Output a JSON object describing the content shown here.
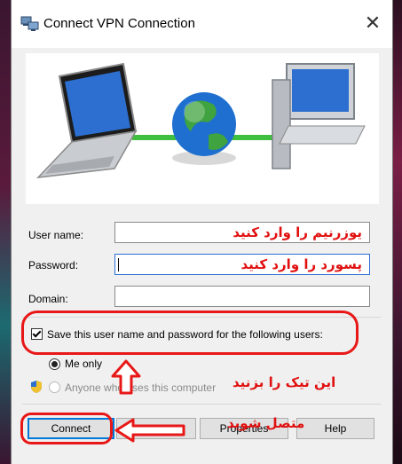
{
  "window": {
    "title": "Connect VPN Connection",
    "close_glyph": "✕"
  },
  "form": {
    "username_label": "User name:",
    "username_value": "یوزرنیم را وارد کنید",
    "password_label": "Password:",
    "password_value": "پسورد  را وارد کنید",
    "domain_label": "Domain:",
    "domain_value": ""
  },
  "save_option": {
    "checkbox_label": "Save this user name and password for the following users:",
    "checked": true,
    "me_only_label": "Me only",
    "anyone_label": "Anyone who uses this computer"
  },
  "buttons": {
    "connect": "Connect",
    "cancel": "Cancel",
    "properties": "Properties",
    "help": "Help"
  },
  "annotations": {
    "tick_hint": "این تیک را بزنید",
    "connect_hint": "متصل شوید"
  },
  "colors": {
    "annotation": "#e81818",
    "focus": "#0078d7"
  }
}
